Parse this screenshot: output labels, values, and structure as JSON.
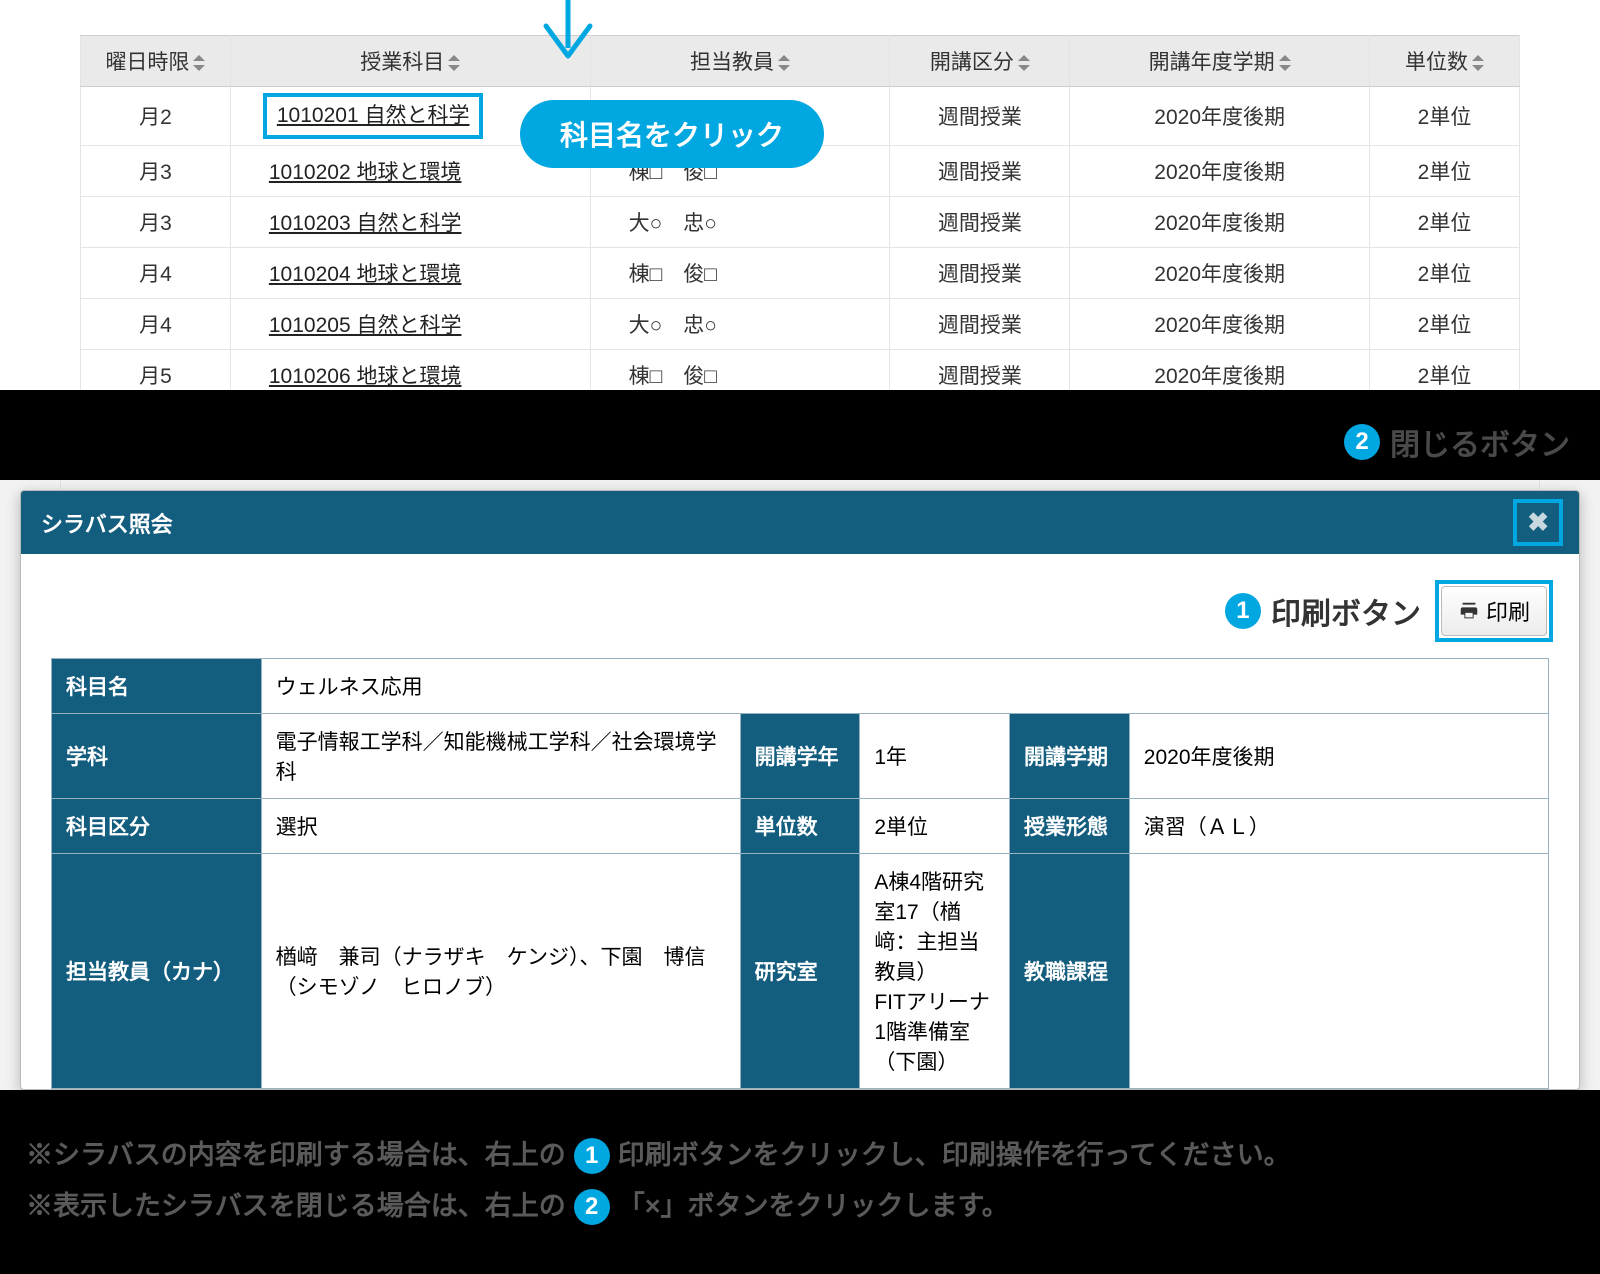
{
  "table": {
    "headers": {
      "day": "曜日時限",
      "subject": "授業科目",
      "faculty": "担当教員",
      "category": "開講区分",
      "term": "開講年度学期",
      "credits": "単位数"
    },
    "rows": [
      {
        "day": "月2",
        "subject": "1010201 自然と科学",
        "faculty": "",
        "category": "週間授業",
        "term": "2020年度後期",
        "credits": "2単位"
      },
      {
        "day": "月3",
        "subject": "1010202 地球と環境",
        "faculty": "棟□　俊□",
        "category": "週間授業",
        "term": "2020年度後期",
        "credits": "2単位"
      },
      {
        "day": "月3",
        "subject": "1010203 自然と科学",
        "faculty": "大○　忠○",
        "category": "週間授業",
        "term": "2020年度後期",
        "credits": "2単位"
      },
      {
        "day": "月4",
        "subject": "1010204 地球と環境",
        "faculty": "棟□　俊□",
        "category": "週間授業",
        "term": "2020年度後期",
        "credits": "2単位"
      },
      {
        "day": "月4",
        "subject": "1010205 自然と科学",
        "faculty": "大○　忠○",
        "category": "週間授業",
        "term": "2020年度後期",
        "credits": "2単位"
      },
      {
        "day": "月5",
        "subject": "1010206 地球と環境",
        "faculty": "棟□　俊□",
        "category": "週間授業",
        "term": "2020年度後期",
        "credits": "2単位"
      }
    ]
  },
  "callout": "科目名をクリック",
  "annotations": {
    "close_label": "閉じるボタン",
    "print_label": "印刷ボタン"
  },
  "dialog": {
    "title": "シラバス照会",
    "print_btn": "印刷",
    "fields": {
      "subject_name_h": "科目名",
      "subject_name": "ウェルネス応用",
      "dept_h": "学科",
      "dept": "電子情報工学科／知能機械工学科／社会環境学科",
      "grade_h": "開講学年",
      "grade": "1年",
      "term_h": "開講学期",
      "term": "2020年度後期",
      "class_cat_h": "科目区分",
      "class_cat": "選択",
      "credits_h": "単位数",
      "credits": "2単位",
      "style_h": "授業形態",
      "style": "演習（ＡＬ）",
      "faculty_h": "担当教員（カナ）",
      "faculty": "楢﨑　兼司（ナラザキ　ケンジ）、下園　博信（シモゾノ　ヒロノブ）",
      "lab_h": "研究室",
      "lab": "A棟4階研究室17（楢﨑：主担当教員）\nFITアリーナ1階準備室（下園）",
      "teach_h": "教職課程",
      "teach": ""
    }
  },
  "notes": {
    "line1a": "※シラバスの内容を印刷する場合は、右上の",
    "line1b": "印刷ボタンをクリックし、印刷操作を行ってください。",
    "line2a": "※表示したシラバスを閉じる場合は、右上の",
    "line2b": "「×」ボタンをクリックします。"
  }
}
